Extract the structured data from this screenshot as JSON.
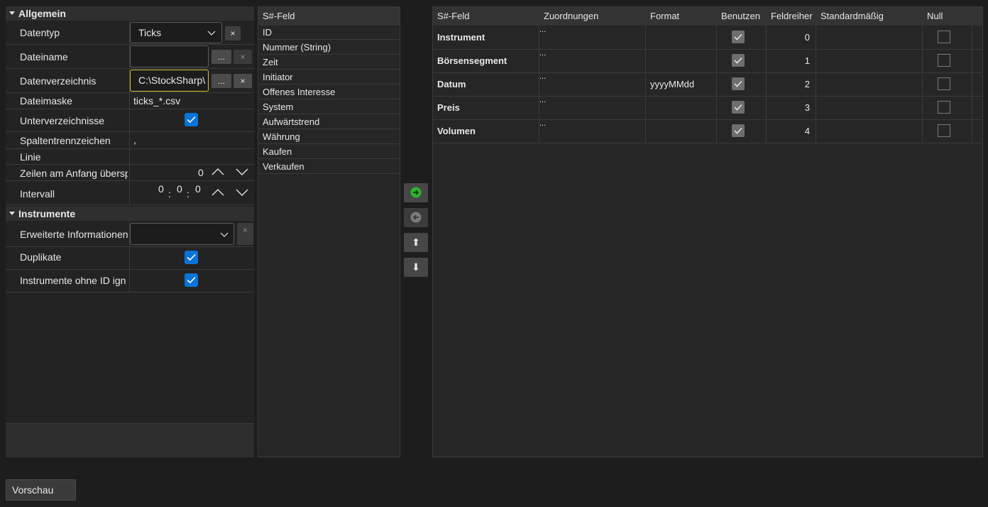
{
  "properties": {
    "general_category": "Allgemein",
    "instruments_category": "Instrumente",
    "data_type_label": "Datentyp",
    "data_type_value": "Ticks",
    "file_name_label": "Dateiname",
    "file_name_value": "",
    "directory_label": "Datenverzeichnis",
    "directory_value": "C:\\StockSharp\\",
    "file_mask_label": "Dateimaske",
    "file_mask_value": "ticks_*.csv",
    "subdirs_label": "Unterverzeichnisse",
    "subdirs_checked": true,
    "separator_label": "Spaltentrennzeichen",
    "separator_value": ",",
    "line_label": "Linie",
    "skip_lines_label": "Zeilen am Anfang übersp",
    "skip_lines_value": "0",
    "interval_label": "Intervall",
    "interval_h": "0",
    "interval_m": "0",
    "interval_s": "0",
    "interval_sep": ":",
    "ext_info_label": "Erweiterte Informationen",
    "ext_info_value": "",
    "duplicates_label": "Duplikate",
    "duplicates_checked": true,
    "ignore_no_id_label": "Instrumente ohne ID ign",
    "ignore_no_id_checked": true,
    "browse_label": "...",
    "clear_label": "×"
  },
  "field_list": {
    "header": "S#-Feld",
    "items": [
      "ID",
      "Nummer (String)",
      "Zeit",
      "Initiator",
      "Offenes Interesse",
      "System",
      "Aufwärtstrend",
      "Währung",
      "Kaufen",
      "Verkaufen"
    ]
  },
  "middle_buttons": {
    "add_icon": "arrow-right-circle-icon",
    "remove_icon": "arrow-left-circle-icon",
    "up_icon": "arrow-up-icon",
    "down_icon": "arrow-down-icon",
    "up_glyph": "⬆",
    "down_glyph": "⬇"
  },
  "mapping_table": {
    "columns": [
      "S#-Feld",
      "Zuordnungen",
      "Format",
      "Benutzen",
      "Feldreiher",
      "Standardmäßig",
      "Null"
    ],
    "rows": [
      {
        "field": "Instrument",
        "mapping": "...",
        "format": "",
        "use": true,
        "order": "0",
        "default": "",
        "null": false
      },
      {
        "field": "Börsensegment",
        "mapping": "...",
        "format": "",
        "use": true,
        "order": "1",
        "default": "",
        "null": false
      },
      {
        "field": "Datum",
        "mapping": "...",
        "format": "yyyyMMdd",
        "use": true,
        "order": "2",
        "default": "",
        "null": false
      },
      {
        "field": "Preis",
        "mapping": "...",
        "format": "",
        "use": true,
        "order": "3",
        "default": "",
        "null": false
      },
      {
        "field": "Volumen",
        "mapping": "...",
        "format": "",
        "use": true,
        "order": "4",
        "default": "",
        "null": false
      }
    ]
  },
  "preview_label": "Vorschau",
  "colors": {
    "accent": "#0a73d9",
    "focus_border": "#d9c034",
    "add_green": "#2bb52b"
  }
}
